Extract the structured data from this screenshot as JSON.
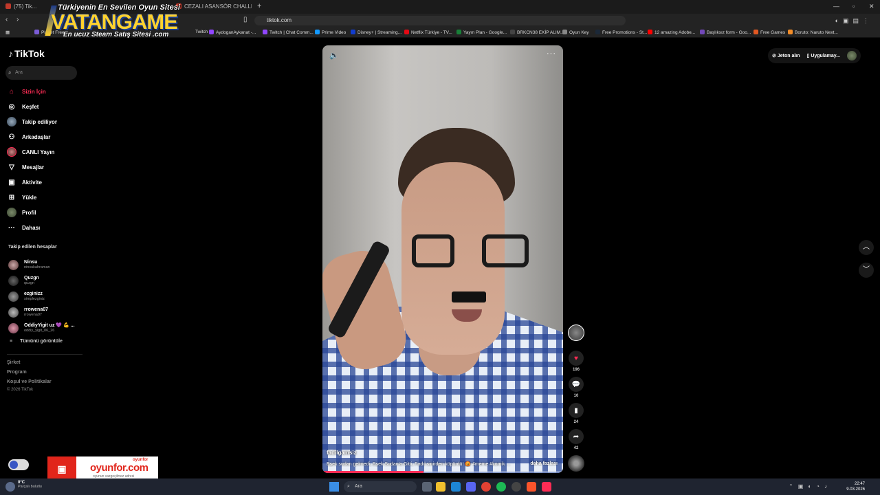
{
  "browser": {
    "tabs": [
      {
        "label": "(75) Tik..."
      },
      {
        "label": "CEZALI ASANSÖR CHALLENGE"
      }
    ],
    "url": "tiktok.com",
    "bookmarks": [
      {
        "label": "Planet Free...",
        "color": "#7b5cd6"
      },
      {
        "label": "Twitch",
        "color": "#9146ff"
      },
      {
        "label": "AydoganAykanat -...",
        "color": "#9146ff"
      },
      {
        "label": "Twitch | Chat Comm...",
        "color": "#9146ff"
      },
      {
        "label": "Prime Video",
        "color": "#1399ff"
      },
      {
        "label": "Disney+ | Streaming...",
        "color": "#113ccf"
      },
      {
        "label": "Netflix Türkiye - TV...",
        "color": "#e50914"
      },
      {
        "label": "Yayın Plan - Google...",
        "color": "#188038"
      },
      {
        "label": "BRKCN38 EKİP ALIM...",
        "color": "#444444"
      },
      {
        "label": "Oyun Key",
        "color": "#888888"
      },
      {
        "label": "Free Promotions - St...",
        "color": "#1b2838"
      },
      {
        "label": "12 amazing Adobe...",
        "color": "#ff0000"
      },
      {
        "label": "Başlıksız form - Goo...",
        "color": "#7248b9"
      },
      {
        "label": "Free Games",
        "color": "#e25822"
      },
      {
        "label": "Boruto: Naruto Next...",
        "color": "#f28c28"
      }
    ]
  },
  "overlay": {
    "top": "Türkiyenin En Sevilen Oyun Sitesi",
    "main": "VATANGAME",
    "bottom": "En ucuz Steam Satış Sitesi .com"
  },
  "sidebar": {
    "logo": "TikTok",
    "search_placeholder": "Ara",
    "menu": [
      {
        "label": "Sizin İçin",
        "icon": "home-icon",
        "active": true
      },
      {
        "label": "Keşfet",
        "icon": "compass-icon"
      },
      {
        "label": "Takip ediliyor",
        "icon": "following-icon"
      },
      {
        "label": "Arkadaşlar",
        "icon": "friends-icon"
      },
      {
        "label": "CANLI Yayın",
        "icon": "live-icon"
      },
      {
        "label": "Mesajlar",
        "icon": "messages-icon"
      },
      {
        "label": "Aktivite",
        "icon": "activity-icon"
      },
      {
        "label": "Yükle",
        "icon": "upload-icon"
      },
      {
        "label": "Profil",
        "icon": "profile-icon"
      },
      {
        "label": "Dahası",
        "icon": "more-icon"
      }
    ],
    "following_title": "Takip edilen hesaplar",
    "following": [
      {
        "name": "Ninsu",
        "user": "ninsukahraman"
      },
      {
        "name": "Quzgn",
        "user": "quzgn"
      },
      {
        "name": "ezginizz",
        "user": "simplezginiz"
      },
      {
        "name": "rrowena07",
        "user": "rrowena07"
      },
      {
        "name": "OddiyYigit uz 💜 💪 ...",
        "user": "oddiy_yigit_06_26"
      }
    ],
    "see_all": "Tümünü görüntüle",
    "footer": [
      "Şirket",
      "Program",
      "Koşul ve Politikalar"
    ],
    "copyright": "© 2026 TikTok"
  },
  "video": {
    "author": "fadilgamsiz",
    "caption": "Eşek sudan gelmedi, Eşek Sudan'a Gitti, Fadıl sinirden köpürdü! 😡 #meme #komik ...",
    "more": "daha fazlası",
    "progress": 0.42
  },
  "actions": {
    "likes": "196",
    "comments": "10",
    "saves": "24",
    "shares": "42"
  },
  "topright": {
    "coins": "Jeton alın",
    "app": "Uygulamay..."
  },
  "banner": {
    "name": "oyunfor.com",
    "tag": "oyunun vazgeçilmez adresi",
    "small": "oyunfor"
  },
  "taskbar": {
    "temp": "0°C",
    "weather": "Parçalı bulutlu",
    "search": "Ara",
    "time": "22:47",
    "date": "9.03.2026"
  }
}
